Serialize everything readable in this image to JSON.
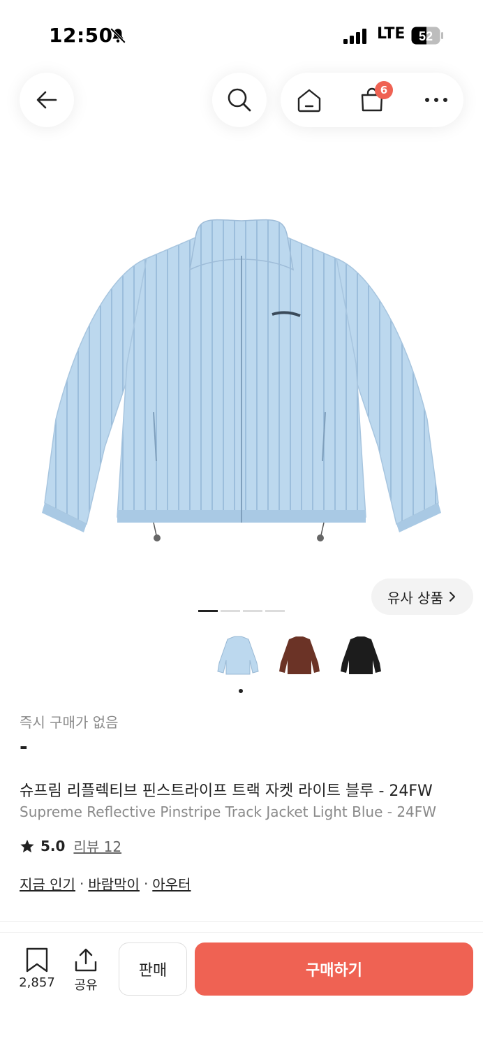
{
  "status_bar": {
    "time": "12:50",
    "network": "LTE",
    "battery": "52"
  },
  "header": {
    "cart_count": "6"
  },
  "gallery": {
    "similar_label": "유사 상품",
    "page_count": 4,
    "active_page": 1
  },
  "variants": [
    {
      "color_name": "light-blue",
      "color": "#bcd8ee"
    },
    {
      "color_name": "brown",
      "color": "#6b3326"
    },
    {
      "color_name": "black",
      "color": "#1c1c1c"
    }
  ],
  "product": {
    "instant_label": "즉시 구매가 없음",
    "price": "-",
    "title_ko": "슈프림 리플렉티브 핀스트라이프 트랙 자켓 라이트 블루 - 24FW",
    "title_en": "Supreme Reflective Pinstripe Track Jacket Light Blue - 24FW",
    "rating": "5.0",
    "review_label": "리뷰 12",
    "tags": [
      "지금 인기",
      "바람막이",
      "아우터"
    ],
    "tag_separator": "·"
  },
  "bottom_bar": {
    "bookmark_count": "2,857",
    "share_label": "공유",
    "sell_label": "판매",
    "buy_label": "구매하기"
  },
  "colors": {
    "accent": "#ef6253",
    "jacket": "#bcd8ee"
  }
}
